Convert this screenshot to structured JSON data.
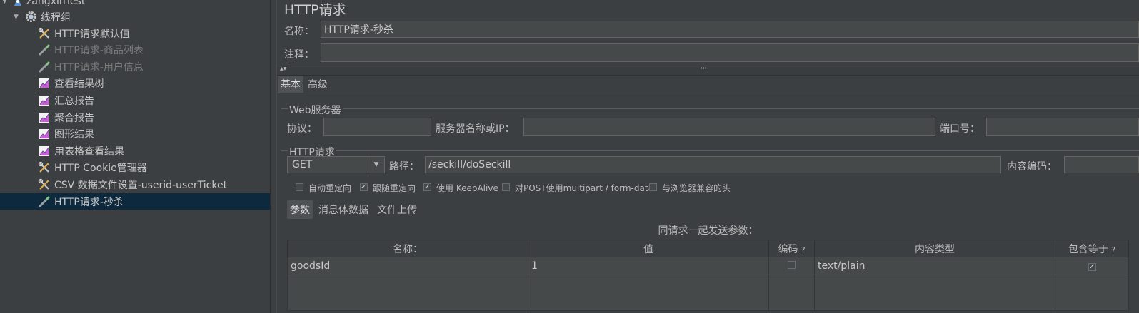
{
  "tree": {
    "root_label": "zangxinTest",
    "group_label": "线程组",
    "items": [
      {
        "label": "HTTP请求默认值",
        "icon": "wrench-screwdriver-icon"
      },
      {
        "label": "HTTP请求-商品列表",
        "icon": "pipette-icon"
      },
      {
        "label": "HTTP请求-用户信息",
        "icon": "pipette-icon"
      },
      {
        "label": "查看结果树",
        "icon": "graph-icon"
      },
      {
        "label": "汇总报告",
        "icon": "graph-icon"
      },
      {
        "label": "聚合报告",
        "icon": "graph-icon"
      },
      {
        "label": "图形结果",
        "icon": "graph-icon"
      },
      {
        "label": "用表格查看结果",
        "icon": "graph-icon"
      },
      {
        "label": "HTTP Cookie管理器",
        "icon": "wrench-screwdriver-icon"
      },
      {
        "label": "CSV 数据文件设置-userid-userTicket",
        "icon": "wrench-screwdriver-icon"
      },
      {
        "label": "HTTP请求-秒杀",
        "icon": "pipette-icon"
      }
    ]
  },
  "panel": {
    "title": "HTTP请求",
    "name_label": "名称：",
    "name_value": "HTTP请求-秒杀",
    "comment_label": "注释：",
    "comment_value": "",
    "tabs": {
      "basic": "基本",
      "advanced": "高级"
    },
    "web_server": {
      "group_title": "Web服务器",
      "protocol_label": "协议：",
      "protocol_value": "",
      "server_label": "服务器名称或IP：",
      "server_value": "",
      "port_label": "端口号：",
      "port_value": ""
    },
    "http_request": {
      "group_title": "HTTP请求",
      "method": "GET",
      "path_label": "路径：",
      "path_value": "/seckill/doSeckill",
      "encoding_label": "内容编码：",
      "encoding_value": ""
    },
    "options": [
      {
        "label": "自动重定向",
        "checked": false
      },
      {
        "label": "跟随重定向",
        "checked": true
      },
      {
        "label": "使用 KeepAlive",
        "checked": true
      },
      {
        "label": "对POST使用multipart / form-data",
        "checked": false
      },
      {
        "label": "与浏览器兼容的头",
        "checked": false
      }
    ],
    "subtabs": {
      "params": "参数",
      "body": "消息体数据",
      "files": "文件上传"
    },
    "params_caption": "同请求一起发送参数：",
    "columns": {
      "name": "名称：",
      "value": "值",
      "encode": "编码",
      "content_type": "内容类型",
      "include_equals": "包含等于"
    },
    "help_mark": "?",
    "rows": [
      {
        "name": "goodsId",
        "value": "1",
        "encode": false,
        "content_type": "text/plain",
        "include_equals": true
      }
    ],
    "check_mark": "✓",
    "splitter_up": "▲▼",
    "splitter_dots": "•••",
    "dropdown_arrow": "▼",
    "tree_arrow": "▼"
  },
  "colors": {
    "accent_selected": "#0d293e",
    "background": "#3c3f41"
  }
}
